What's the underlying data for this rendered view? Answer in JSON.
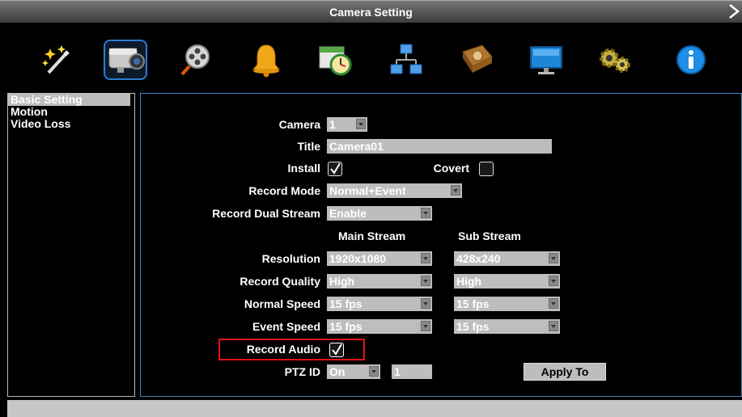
{
  "window": {
    "title": "Camera Setting"
  },
  "toolbar": {
    "items": [
      {
        "name": "wizard"
      },
      {
        "name": "camera",
        "active": true
      },
      {
        "name": "record"
      },
      {
        "name": "event"
      },
      {
        "name": "schedule"
      },
      {
        "name": "network"
      },
      {
        "name": "storage"
      },
      {
        "name": "display"
      },
      {
        "name": "system"
      },
      {
        "name": "info"
      }
    ]
  },
  "sidebar": {
    "items": [
      {
        "label": "Basic Setting",
        "selected": true
      },
      {
        "label": "Motion"
      },
      {
        "label": "Video Loss"
      }
    ]
  },
  "form": {
    "camera": {
      "label": "Camera",
      "value": "1"
    },
    "title": {
      "label": "Title",
      "value": "Camera01"
    },
    "install": {
      "label": "Install",
      "checked": true
    },
    "covert": {
      "label": "Covert",
      "checked": false
    },
    "record_mode": {
      "label": "Record Mode",
      "value": "Normal+Event"
    },
    "record_dual_stream": {
      "label": "Record Dual Stream",
      "value": "Enable"
    },
    "main_stream_header": "Main Stream",
    "sub_stream_header": "Sub Stream",
    "resolution": {
      "label": "Resolution",
      "main": "1920x1080",
      "sub": "428x240"
    },
    "record_quality": {
      "label": "Record Quality",
      "main": "High",
      "sub": "High"
    },
    "normal_speed": {
      "label": "Normal Speed",
      "main": "15 fps",
      "sub": "15 fps"
    },
    "event_speed": {
      "label": "Event Speed",
      "main": "15 fps",
      "sub": "15 fps"
    },
    "record_audio": {
      "label": "Record Audio",
      "checked": true
    },
    "ptz_id": {
      "label": "PTZ ID",
      "value": "On",
      "number": "1"
    },
    "apply_to": "Apply To"
  },
  "colors": {
    "highlight": "#e0141b",
    "panel_border": "#4b82b8",
    "field_bg": "#bdbdbd"
  }
}
